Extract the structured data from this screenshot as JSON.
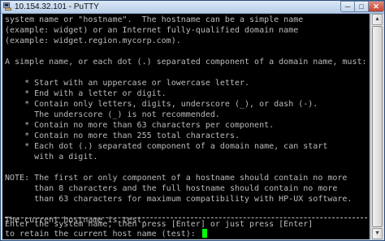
{
  "window": {
    "title": "10.154.32.101 - PuTTY",
    "controls": {
      "minimize": "─",
      "maximize": "□",
      "close": "✕"
    }
  },
  "terminal": {
    "lines": [
      "system name or \"hostname\".  The hostname can be a simple name",
      "(example: widget) or an Internet fully-qualified domain name",
      "(example: widget.region.mycorp.com).",
      "",
      "A simple name, or each dot (.) separated component of a domain name, must:",
      "",
      "    * Start with an uppercase or lowercase letter.",
      "    * End with a letter or digit.",
      "    * Contain only letters, digits, underscore (_), or dash (-).",
      "      The underscore (_) is not recommended.",
      "    * Contain no more than 63 characters per component.",
      "    * Contain no more than 255 total characters.",
      "    * Each dot (.) separated component of a domain name, can start",
      "      with a digit.",
      "",
      "NOTE: The first or only component of a hostname should contain no more",
      "      than 8 characters and the full hostname should contain no more",
      "      than 63 characters for maximum compatibility with HP-UX software.",
      "",
      "The current hostname is test.",
      "",
      "",
      "Enter the system name, then press [Enter] or just press [Enter]",
      "to retain the current host name (test): "
    ],
    "text_color": "#bbbbbb",
    "cursor_color": "#00ff00"
  },
  "scrollbar": {
    "up_glyph": "▲",
    "down_glyph": "▼"
  }
}
